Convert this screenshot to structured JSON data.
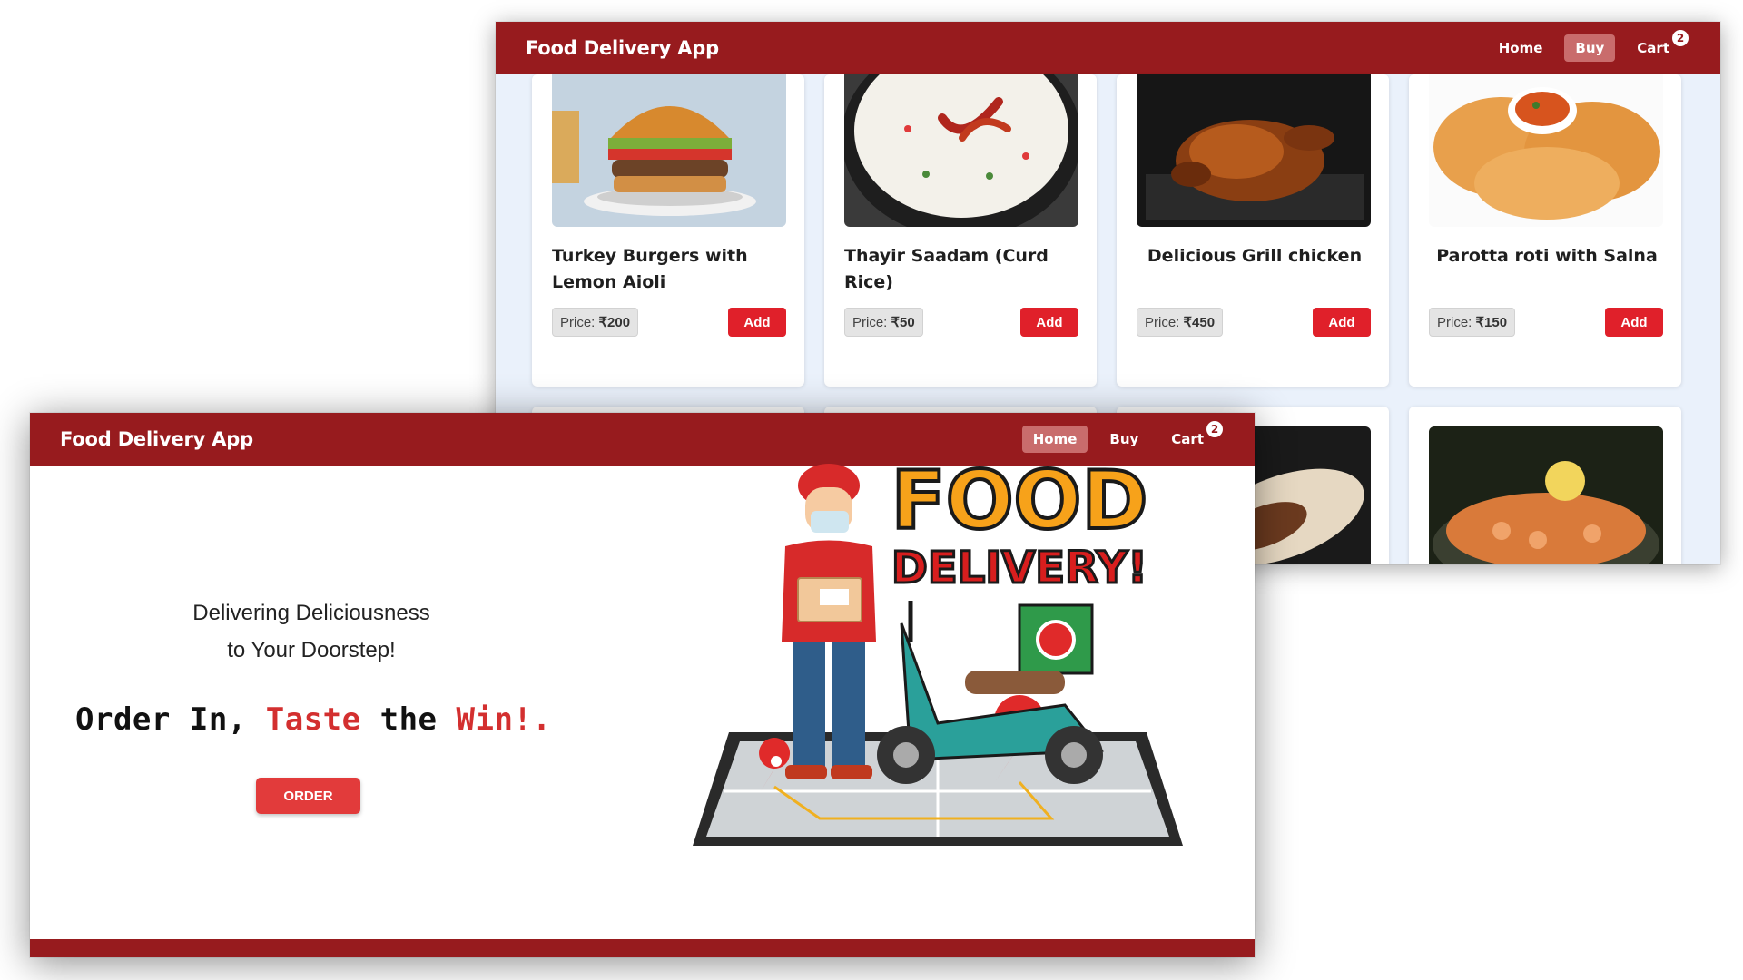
{
  "back_window": {
    "brand": "Food Delivery App",
    "nav": [
      {
        "label": "Home",
        "active": false
      },
      {
        "label": "Buy",
        "active": true
      },
      {
        "label": "Cart",
        "active": false
      }
    ],
    "cart_count": "2",
    "price_prefix": "Price: ",
    "add_label": "Add",
    "products": [
      {
        "name": "Turkey Burgers with Lemon Aioli",
        "price": "₹200",
        "image": "burger-image"
      },
      {
        "name": "Thayir Saadam (Curd Rice)",
        "price": "₹50",
        "image": "curd-rice-image"
      },
      {
        "name": "Delicious Grill chicken",
        "price": "₹450",
        "image": "grill-chicken-image"
      },
      {
        "name": "Parotta roti with Salna",
        "price": "₹150",
        "image": "parotta-image"
      }
    ],
    "row2_images": [
      "dark-dish-image",
      "brown-dish-image",
      "shawarma-image",
      "shrimp-image"
    ]
  },
  "front_window": {
    "brand": "Food Delivery App",
    "nav": [
      {
        "label": "Home",
        "active": true
      },
      {
        "label": "Buy",
        "active": false
      },
      {
        "label": "Cart",
        "active": false
      }
    ],
    "cart_count": "2",
    "tagline_line1": "Delivering Deliciousness",
    "tagline_line2": "to Your Doorstep!",
    "headline": {
      "w1": "Order",
      "w2": "In,",
      "w3": "Taste",
      "w4": "the",
      "w5": "Win!."
    },
    "order_button": "ORDER",
    "illustration": {
      "line1": "FOOD",
      "line2": "DELIVERY!"
    }
  },
  "colors": {
    "nav": "#971b1e",
    "accent": "#e0202a",
    "page_bg": "#eaf1fb"
  }
}
